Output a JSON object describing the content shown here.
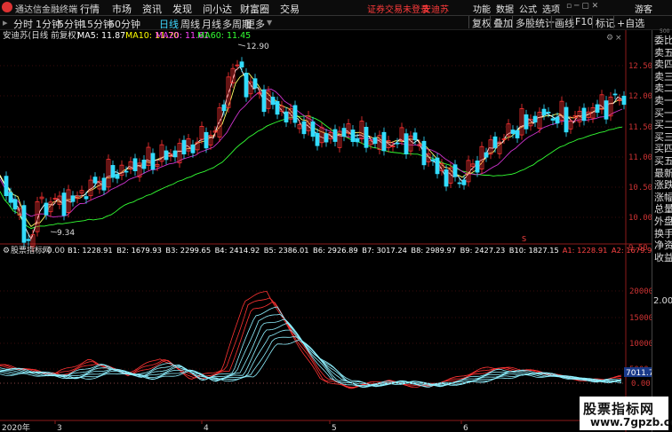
{
  "app": {
    "name": "通达信金融终端"
  },
  "menu": [
    "行情",
    "市场",
    "资讯",
    "发现",
    "问小达",
    "财富圈",
    "交易"
  ],
  "notice": "证券交易未登录",
  "stock_name_top": "安迪苏",
  "menu_right": [
    "功能",
    "数据",
    "公式",
    "选项"
  ],
  "guest": "游客",
  "periods": [
    "分时",
    "1分钟",
    "5分钟",
    "15分钟",
    "60分钟",
    "日线",
    "周线",
    "月线",
    "多周期",
    "更多"
  ],
  "active_period": "日线",
  "right_tools": [
    "复权",
    "叠加",
    "多股",
    "统计",
    "画线",
    "F10",
    "标记",
    "+自选"
  ],
  "main": {
    "title": "安迪苏(日线 前复权)",
    "ma": [
      {
        "label": "MA5: 11.87",
        "color": "#ffffff"
      },
      {
        "label": "MA10: 11.70",
        "color": "#ffff00"
      },
      {
        "label": "MA20: 11.61",
        "color": "#ff44ff"
      },
      {
        "label": "MA60: 11.45",
        "color": "#33ff33"
      }
    ],
    "high_label": "12.90",
    "low_label": "9.34",
    "yticks": [
      "12.50",
      "12.00",
      "11.50",
      "11.00",
      "10.50",
      "10.00",
      "9.50"
    ],
    "mark_s": "S"
  },
  "indicator": {
    "title": "股票指标网",
    "value": ": 0.00",
    "labels": [
      {
        "t": "B1: 1228.91",
        "c": "#ffffff"
      },
      {
        "t": "B2: 1679.93",
        "c": "#ffffff"
      },
      {
        "t": "B3: 2299.65",
        "c": "#ffffff"
      },
      {
        "t": "B4: 2414.92",
        "c": "#ffffff"
      },
      {
        "t": "B5: 2386.01",
        "c": "#ffffff"
      },
      {
        "t": "B6: 2926.89",
        "c": "#ffffff"
      },
      {
        "t": "B7: 3017.24",
        "c": "#ffffff"
      },
      {
        "t": "B8: 2989.97",
        "c": "#ffffff"
      },
      {
        "t": "B9: 2427.23",
        "c": "#ffffff"
      },
      {
        "t": "B10: 1827.15",
        "c": "#ffffff"
      },
      {
        "t": "A1: 1228.91",
        "c": "#ff4444"
      },
      {
        "t": "A2: 1679.93",
        "c": "#ff4444"
      },
      {
        "t": "A3: 2299.65",
        "c": "#ff4444"
      },
      {
        "t": "A4: 24",
        "c": "#ff4444"
      }
    ],
    "yticks": [
      "20000",
      "15000",
      "10000",
      "5000",
      "0.00"
    ],
    "current_value": "7011.77"
  },
  "xaxis": [
    "2020年",
    "3",
    "4",
    "5",
    "6"
  ],
  "rpanel_items": [
    "委比",
    "卖五",
    "卖四",
    "卖三",
    "卖二",
    "卖一",
    "买一",
    "买二",
    "买三",
    "买四",
    "买五",
    "最新",
    "涨跌",
    "涨幅",
    "总量",
    "外盘",
    "换手",
    "净资",
    "收益"
  ],
  "rpanel_bottom": "2.00%",
  "rpanel_top_small": "500",
  "watermark": {
    "line1": "股票指标网",
    "line2": "www.7gpzb.com"
  }
}
